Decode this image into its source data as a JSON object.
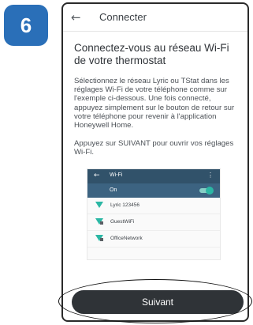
{
  "step_badge": "6",
  "appbar": {
    "back_icon": "arrow-left-icon",
    "title": "Connecter"
  },
  "content": {
    "heading": "Connectez-vous au réseau Wi-Fi de votre thermostat",
    "instructions": "Sélectionnez le réseau Lyric ou TStat dans les réglages Wi-Fi de votre téléphone comme sur l'exemple ci-dessous. Une fois connecté, appuyez simplement sur le bouton de retour sur votre téléphone pour revenir à l'application Honeywell Home.",
    "open_wifi_hint": "Appuyez sur SUIVANT pour ouvrir vos réglages Wi-Fi."
  },
  "wifi_example": {
    "title": "Wi-Fi",
    "back_icon": "arrow-left-icon",
    "menu_icon": "more-vertical-icon",
    "on_label": "On",
    "toggle_on": true,
    "networks": [
      {
        "name": "Lyric 123456",
        "icon": "wifi-open-icon"
      },
      {
        "name": "GuestWiFi",
        "icon": "wifi-locked-icon"
      },
      {
        "name": "OfficeNetwork",
        "icon": "wifi-locked-icon"
      }
    ],
    "colors": {
      "header": "#31526a",
      "on_bar": "#3c6381",
      "wifi_icon": "#2bb7a4"
    }
  },
  "next_button": {
    "label": "Suivant"
  },
  "colors": {
    "badge": "#2a6fb8",
    "button": "#2f3337"
  }
}
